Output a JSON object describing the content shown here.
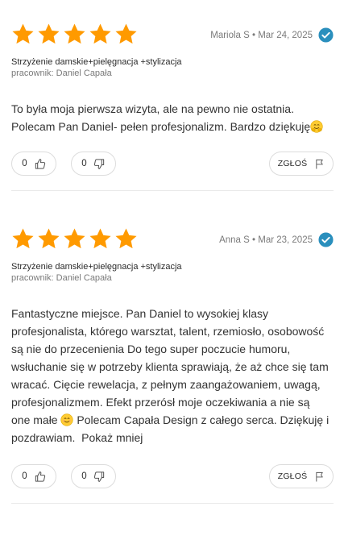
{
  "colors": {
    "star": "#ff9a00",
    "verified": "#2a8fbd",
    "divider": "#e9e9e9",
    "button_border": "#dcdcdc"
  },
  "reviews": [
    {
      "rating": 5,
      "author_date": "Mariola S • Mar 24, 2025",
      "verified_icon": "verified-check-icon",
      "service": "Strzyżenie damskie+pielęgnacja +stylizacja",
      "employee": "pracownik: Daniel Capała",
      "text": "To była moja pierwsza wizyta, ale na pewno nie ostatnia. Polecam Pan Daniel- pełen profesjonalizm. Bardzo dziękuję",
      "emoji_icon": "hugging-face-icon",
      "upvotes": "0",
      "downvotes": "0",
      "report_label": "ZGŁOŚ"
    },
    {
      "rating": 5,
      "author_date": "Anna S • Mar 23, 2025",
      "verified_icon": "verified-check-icon",
      "service": "Strzyżenie damskie+pielęgnacja +stylizacja",
      "employee": "pracownik: Daniel Capała",
      "text_part1": "Fantastyczne miejsce. Pan Daniel to wysokiej klasy profesjonalista, którego warsztat, talent, rzemiosło, osobowość są nie do przecenienia Do tego super poczucie humoru, wsłuchanie się w potrzeby klienta sprawiają, że aż chce się tam wracać. Cięcie rewelacja, z pełnym zaangażowaniem, uwagą, profesjonalizmem. Efekt przerósł moje oczekiwania a nie są one małe",
      "emoji_icon": "smiling-face-icon",
      "text_part2": "Polecam Capała Design z całego serca. Dziękuję i pozdrawiam.",
      "show_less": "Pokaż mniej",
      "upvotes": "0",
      "downvotes": "0",
      "report_label": "ZGŁOŚ"
    }
  ]
}
